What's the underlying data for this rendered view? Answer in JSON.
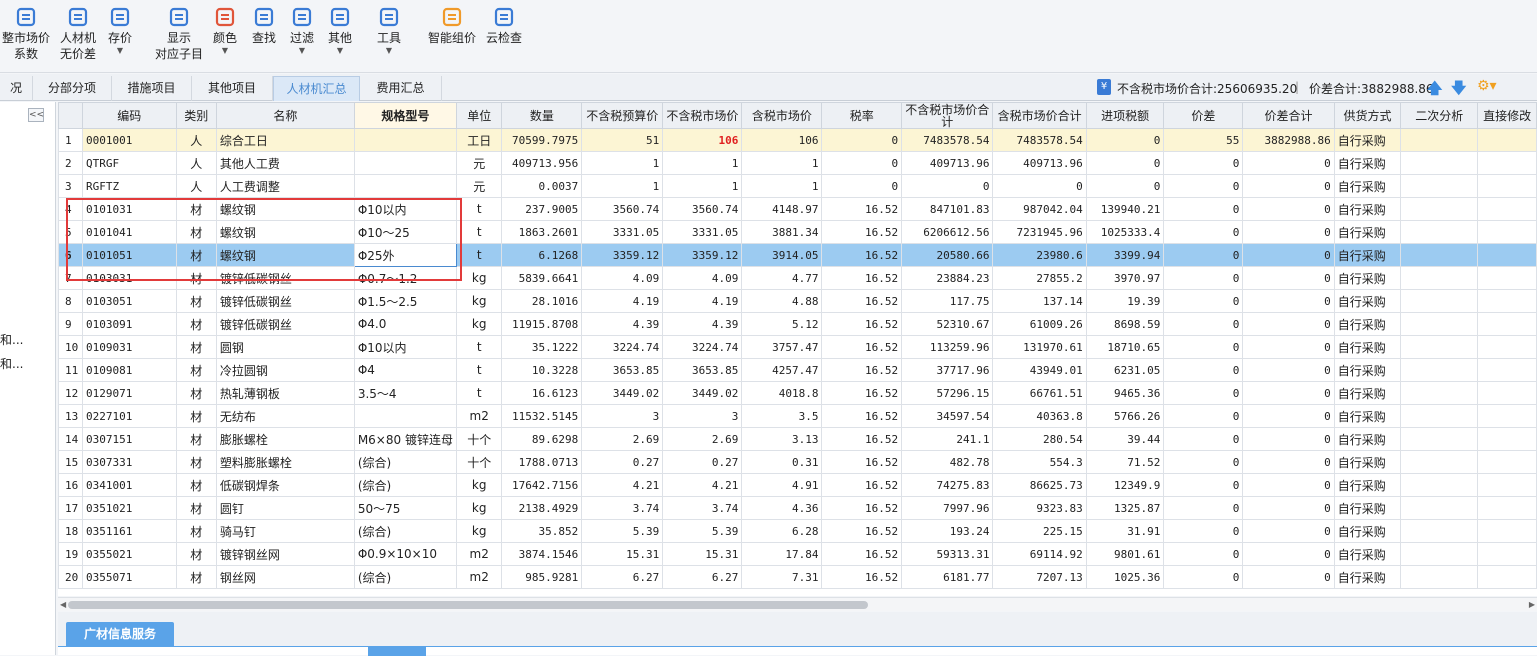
{
  "toolbar": {
    "items": [
      {
        "label": "整市场价",
        "label2": "系数",
        "icon": "adjust-price-icon",
        "color": "#3a7bd5"
      },
      {
        "label": "人材机",
        "label2": "无价差",
        "icon": "scale-icon",
        "color": "#3a7bd5"
      },
      {
        "label": "存价",
        "label2": "",
        "icon": "save-price-icon",
        "color": "#3a7bd5"
      },
      {
        "label": "显示",
        "label2": "对应子目",
        "icon": "display-icon",
        "color": "#3a7bd5"
      },
      {
        "label": "颜色",
        "label2": "",
        "icon": "paint-bucket-icon",
        "color": "#e0553a"
      },
      {
        "label": "查找",
        "label2": "",
        "icon": "binoculars-icon",
        "color": "#3a7bd5"
      },
      {
        "label": "过滤",
        "label2": "",
        "icon": "filter-icon",
        "color": "#3a7bd5"
      },
      {
        "label": "其他",
        "label2": "",
        "icon": "grid-icon",
        "color": "#3a7bd5"
      },
      {
        "label": "工具",
        "label2": "",
        "icon": "toolbox-icon",
        "color": "#3a7bd5"
      },
      {
        "label": "智能组价",
        "label2": "",
        "icon": "smart-price-icon",
        "color": "#f09a2a"
      },
      {
        "label": "云检查",
        "label2": "",
        "icon": "cloud-check-icon",
        "color": "#3a7bd5"
      }
    ]
  },
  "tabs": [
    "况",
    "分部分项",
    "措施项目",
    "其他项目",
    "人材机汇总",
    "费用汇总"
  ],
  "active_tab": "人材机汇总",
  "summary": {
    "no_tax_label": "不含税市场价合计:25606935.20",
    "diff_label": "价差合计:3882988.86"
  },
  "left_panel": {
    "collapse": "<<",
    "items": [
      "和...",
      "和..."
    ]
  },
  "grid": {
    "headers": [
      "",
      "编码",
      "类别",
      "名称",
      "规格型号",
      "单位",
      "数量",
      "不含税预算价",
      "不含税市场价",
      "含税市场价",
      "税率",
      "不含税市场价合计",
      "含税市场价合计",
      "进项税额",
      "价差",
      "价差合计",
      "供货方式",
      "二次分析",
      "直接修改"
    ],
    "rows": [
      [
        "1",
        "0001001",
        "人",
        "综合工日",
        "",
        "工日",
        "70599.7975",
        "51",
        "106",
        "106",
        "0",
        "7483578.54",
        "7483578.54",
        "0",
        "55",
        "3882988.86",
        "自行采购",
        "",
        ""
      ],
      [
        "2",
        "QTRGF",
        "人",
        "其他人工费",
        "",
        "元",
        "409713.956",
        "1",
        "1",
        "1",
        "0",
        "409713.96",
        "409713.96",
        "0",
        "0",
        "0",
        "自行采购",
        "",
        ""
      ],
      [
        "3",
        "RGFTZ",
        "人",
        "人工费调整",
        "",
        "元",
        "0.0037",
        "1",
        "1",
        "1",
        "0",
        "0",
        "0",
        "0",
        "0",
        "0",
        "自行采购",
        "",
        ""
      ],
      [
        "4",
        "0101031",
        "材",
        "螺纹钢",
        "Φ10以内",
        "t",
        "237.9005",
        "3560.74",
        "3560.74",
        "4148.97",
        "16.52",
        "847101.83",
        "987042.04",
        "139940.21",
        "0",
        "0",
        "自行采购",
        "",
        ""
      ],
      [
        "5",
        "0101041",
        "材",
        "螺纹钢",
        "Φ10～25",
        "t",
        "1863.2601",
        "3331.05",
        "3331.05",
        "3881.34",
        "16.52",
        "6206612.56",
        "7231945.96",
        "1025333.4",
        "0",
        "0",
        "自行采购",
        "",
        ""
      ],
      [
        "6",
        "0101051",
        "材",
        "螺纹钢",
        "Φ25外",
        "t",
        "6.1268",
        "3359.12",
        "3359.12",
        "3914.05",
        "16.52",
        "20580.66",
        "23980.6",
        "3399.94",
        "0",
        "0",
        "自行采购",
        "",
        ""
      ],
      [
        "7",
        "0103031",
        "材",
        "镀锌低碳钢丝",
        "Φ0.7～1.2",
        "kg",
        "5839.6641",
        "4.09",
        "4.09",
        "4.77",
        "16.52",
        "23884.23",
        "27855.2",
        "3970.97",
        "0",
        "0",
        "自行采购",
        "",
        ""
      ],
      [
        "8",
        "0103051",
        "材",
        "镀锌低碳钢丝",
        "Φ1.5～2.5",
        "kg",
        "28.1016",
        "4.19",
        "4.19",
        "4.88",
        "16.52",
        "117.75",
        "137.14",
        "19.39",
        "0",
        "0",
        "自行采购",
        "",
        ""
      ],
      [
        "9",
        "0103091",
        "材",
        "镀锌低碳钢丝",
        "Φ4.0",
        "kg",
        "11915.8708",
        "4.39",
        "4.39",
        "5.12",
        "16.52",
        "52310.67",
        "61009.26",
        "8698.59",
        "0",
        "0",
        "自行采购",
        "",
        ""
      ],
      [
        "10",
        "0109031",
        "材",
        "圆钢",
        "Φ10以内",
        "t",
        "35.1222",
        "3224.74",
        "3224.74",
        "3757.47",
        "16.52",
        "113259.96",
        "131970.61",
        "18710.65",
        "0",
        "0",
        "自行采购",
        "",
        ""
      ],
      [
        "11",
        "0109081",
        "材",
        "冷拉圆钢",
        "Φ4",
        "t",
        "10.3228",
        "3653.85",
        "3653.85",
        "4257.47",
        "16.52",
        "37717.96",
        "43949.01",
        "6231.05",
        "0",
        "0",
        "自行采购",
        "",
        ""
      ],
      [
        "12",
        "0129071",
        "材",
        "热轧薄钢板",
        "3.5～4",
        "t",
        "16.6123",
        "3449.02",
        "3449.02",
        "4018.8",
        "16.52",
        "57296.15",
        "66761.51",
        "9465.36",
        "0",
        "0",
        "自行采购",
        "",
        ""
      ],
      [
        "13",
        "0227101",
        "材",
        "无纺布",
        "",
        "m2",
        "11532.5145",
        "3",
        "3",
        "3.5",
        "16.52",
        "34597.54",
        "40363.8",
        "5766.26",
        "0",
        "0",
        "自行采购",
        "",
        ""
      ],
      [
        "14",
        "0307151",
        "材",
        "膨胀螺栓",
        "M6×80 镀锌连母",
        "十个",
        "89.6298",
        "2.69",
        "2.69",
        "3.13",
        "16.52",
        "241.1",
        "280.54",
        "39.44",
        "0",
        "0",
        "自行采购",
        "",
        ""
      ],
      [
        "15",
        "0307331",
        "材",
        "塑料膨胀螺栓",
        "(综合)",
        "十个",
        "1788.0713",
        "0.27",
        "0.27",
        "0.31",
        "16.52",
        "482.78",
        "554.3",
        "71.52",
        "0",
        "0",
        "自行采购",
        "",
        ""
      ],
      [
        "16",
        "0341001",
        "材",
        "低碳钢焊条",
        "(综合)",
        "kg",
        "17642.7156",
        "4.21",
        "4.21",
        "4.91",
        "16.52",
        "74275.83",
        "86625.73",
        "12349.9",
        "0",
        "0",
        "自行采购",
        "",
        ""
      ],
      [
        "17",
        "0351021",
        "材",
        "圆钉",
        "50～75",
        "kg",
        "2138.4929",
        "3.74",
        "3.74",
        "4.36",
        "16.52",
        "7997.96",
        "9323.83",
        "1325.87",
        "0",
        "0",
        "自行采购",
        "",
        ""
      ],
      [
        "18",
        "0351161",
        "材",
        "骑马钉",
        "(综合)",
        "kg",
        "35.852",
        "5.39",
        "5.39",
        "6.28",
        "16.52",
        "193.24",
        "225.15",
        "31.91",
        "0",
        "0",
        "自行采购",
        "",
        ""
      ],
      [
        "19",
        "0355021",
        "材",
        "镀锌钢丝网",
        "Φ0.9×10×10",
        "m2",
        "3874.1546",
        "15.31",
        "15.31",
        "17.84",
        "16.52",
        "59313.31",
        "69114.92",
        "9801.61",
        "0",
        "0",
        "自行采购",
        "",
        ""
      ],
      [
        "20",
        "0355071",
        "材",
        "钢丝网",
        "(综合)",
        "m2",
        "985.9281",
        "6.27",
        "6.27",
        "7.31",
        "16.52",
        "6181.77",
        "7207.13",
        "1025.36",
        "0",
        "0",
        "自行采购",
        "",
        ""
      ]
    ]
  },
  "bottom_tab": "广材信息服务"
}
